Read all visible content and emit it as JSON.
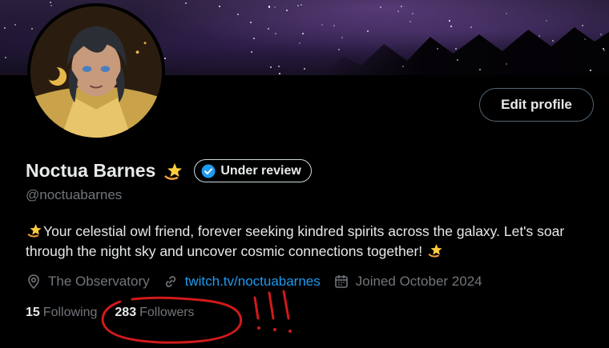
{
  "profile": {
    "display_name": "Noctua Barnes",
    "badge_label": "Under review",
    "handle": "@noctuabarnes",
    "bio_text": "Your celestial owl friend, forever seeking kindred spirits across the galaxy. Let's soar through the night sky and uncover cosmic connections together!",
    "location": "The Observatory",
    "website": "twitch.tv/noctuabarnes",
    "joined": "Joined October 2024"
  },
  "actions": {
    "edit_profile": "Edit profile"
  },
  "stats": {
    "following_count": "15",
    "following_label": "Following",
    "followers_count": "283",
    "followers_label": "Followers"
  },
  "icons": {
    "emoji": "dizzy-star-emoji",
    "badge": "verified-check-icon",
    "location": "location-pin-icon",
    "link": "link-icon",
    "calendar": "calendar-icon"
  },
  "colors": {
    "background": "#000000",
    "text_primary": "#e7e9ea",
    "text_secondary": "#71767b",
    "link": "#1d9bf0",
    "annotation": "#d11a1a"
  }
}
